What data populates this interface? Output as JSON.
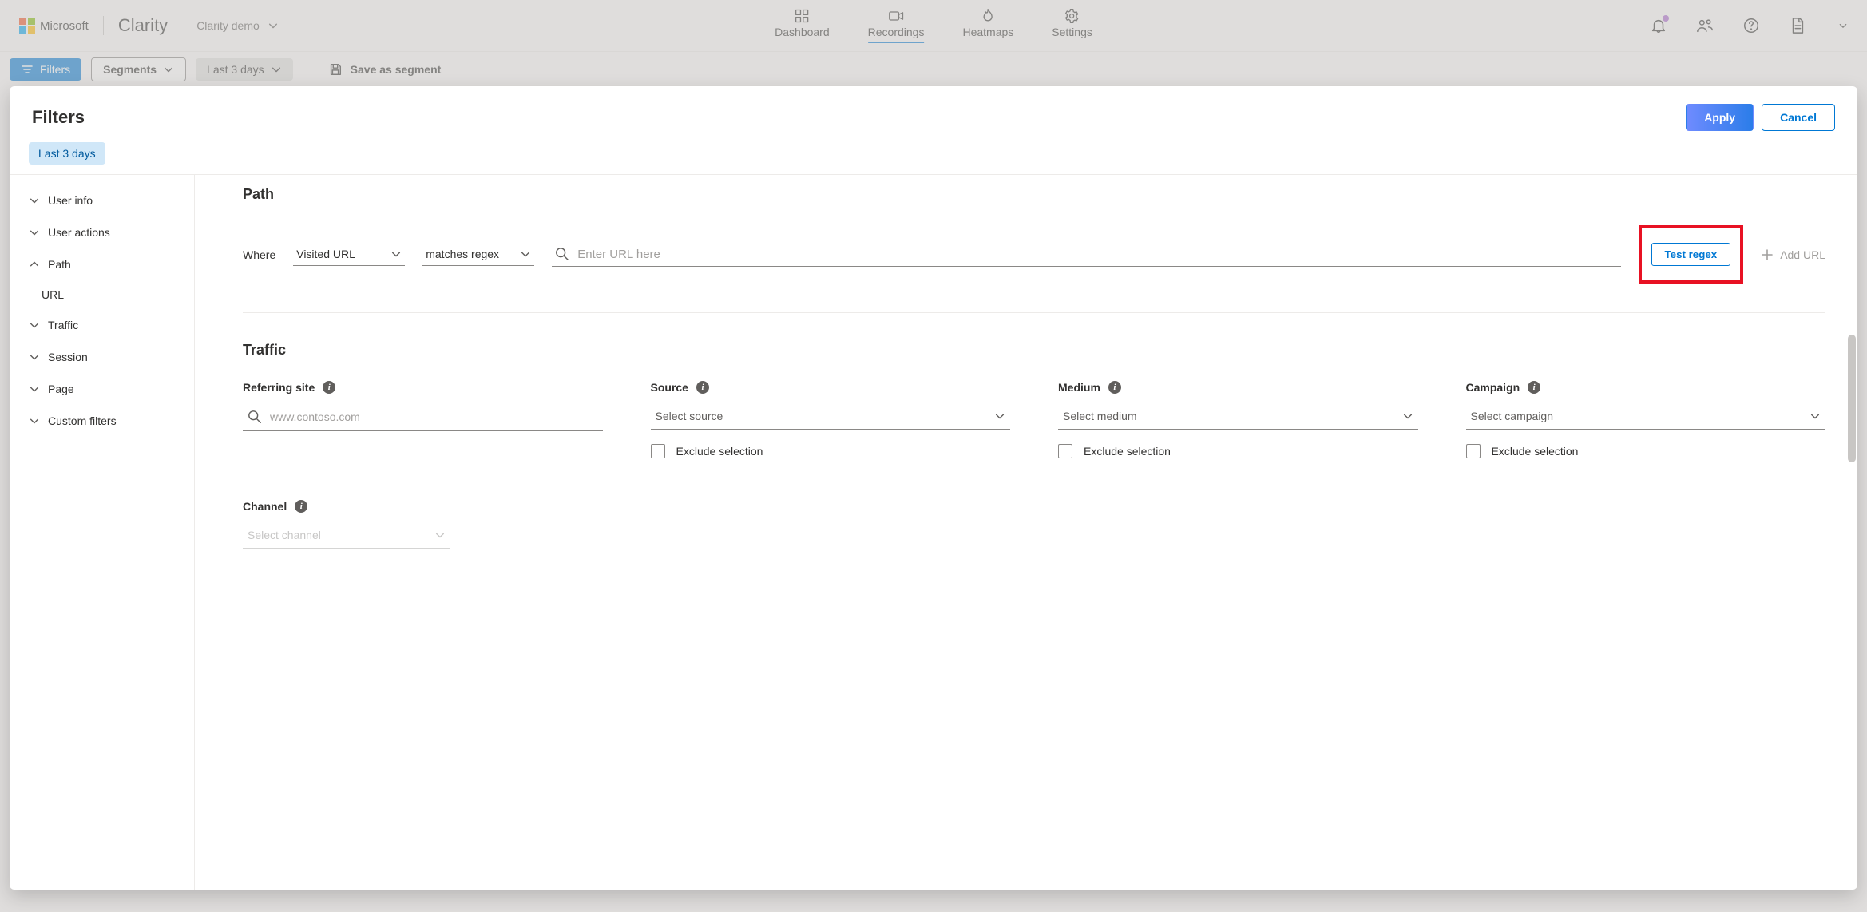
{
  "header": {
    "brand": "Microsoft",
    "product": "Clarity",
    "project": "Clarity demo",
    "nav": {
      "dashboard": "Dashboard",
      "recordings": "Recordings",
      "heatmaps": "Heatmaps",
      "settings": "Settings"
    }
  },
  "subbar": {
    "filters": "Filters",
    "segments": "Segments",
    "daterange": "Last 3 days",
    "save_segment": "Save as segment"
  },
  "modal": {
    "title": "Filters",
    "apply": "Apply",
    "cancel": "Cancel",
    "chip": "Last 3 days"
  },
  "sidebar": {
    "user_info": "User info",
    "user_actions": "User actions",
    "path": "Path",
    "path_sub_url": "URL",
    "traffic": "Traffic",
    "session": "Session",
    "page": "Page",
    "custom": "Custom filters"
  },
  "path": {
    "title": "Path",
    "where": "Where",
    "visited_url": "Visited URL",
    "matches_regex": "matches regex",
    "url_placeholder": "Enter URL here",
    "test_regex": "Test regex",
    "add_url": "Add URL"
  },
  "traffic": {
    "title": "Traffic",
    "referring_site": "Referring site",
    "referring_placeholder": "www.contoso.com",
    "source": "Source",
    "select_source": "Select source",
    "medium": "Medium",
    "select_medium": "Select medium",
    "campaign": "Campaign",
    "select_campaign": "Select campaign",
    "exclude": "Exclude selection",
    "channel": "Channel",
    "select_channel": "Select channel"
  }
}
